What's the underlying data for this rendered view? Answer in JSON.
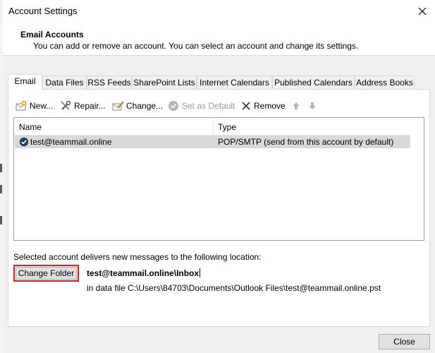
{
  "window": {
    "title": "Account Settings"
  },
  "header": {
    "title": "Email Accounts",
    "description": "You can add or remove an account. You can select an account and change its settings."
  },
  "tabs": [
    {
      "label": "Email",
      "active": true
    },
    {
      "label": "Data Files"
    },
    {
      "label": "RSS Feeds"
    },
    {
      "label": "SharePoint Lists"
    },
    {
      "label": "Internet Calendars"
    },
    {
      "label": "Published Calendars"
    },
    {
      "label": "Address Books"
    }
  ],
  "toolbar": {
    "new_label": "New...",
    "repair_label": "Repair...",
    "change_label": "Change...",
    "set_default_label": "Set as Default",
    "remove_label": "Remove"
  },
  "accounts_list": {
    "columns": [
      "Name",
      "Type"
    ],
    "rows": [
      {
        "name": "test@teammail.online",
        "type": "POP/SMTP (send from this account by default)"
      }
    ]
  },
  "delivery": {
    "label": "Selected account delivers new messages to the following location:",
    "change_folder_label": "Change Folder",
    "folder_path": "test@teammail.online\\Inbox",
    "data_file": "in data file C:\\Users\\84703\\Documents\\Outlook Files\\test@teammail.online.pst"
  },
  "footer": {
    "close_label": "Close"
  },
  "colors": {
    "highlight_border": "#e11d1d",
    "selected_row": "#d9d9d9"
  }
}
